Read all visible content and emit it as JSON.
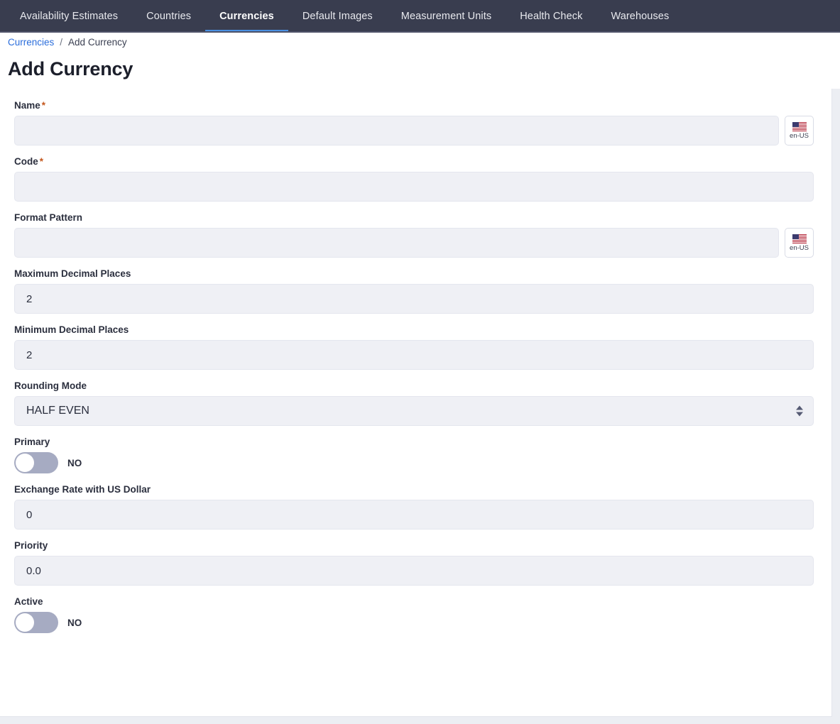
{
  "navbar": {
    "tabs": [
      {
        "label": "Availability Estimates",
        "active": false
      },
      {
        "label": "Countries",
        "active": false
      },
      {
        "label": "Currencies",
        "active": true
      },
      {
        "label": "Default Images",
        "active": false
      },
      {
        "label": "Measurement Units",
        "active": false
      },
      {
        "label": "Health Check",
        "active": false
      },
      {
        "label": "Warehouses",
        "active": false
      }
    ],
    "active_color": "#4a90e2",
    "background": "#393d4f"
  },
  "breadcrumb": {
    "parent": "Currencies",
    "separator": "/",
    "current": "Add Currency"
  },
  "page": {
    "title": "Add Currency"
  },
  "form": {
    "name": {
      "label": "Name",
      "required_marker": "*",
      "value": "",
      "placeholder": "",
      "locale": "en-US",
      "locale_icon": "us-flag-icon"
    },
    "code": {
      "label": "Code",
      "required_marker": "*",
      "value": "",
      "placeholder": ""
    },
    "format_pattern": {
      "label": "Format Pattern",
      "value": "",
      "placeholder": "",
      "locale": "en-US",
      "locale_icon": "us-flag-icon"
    },
    "maximum_decimal_places": {
      "label": "Maximum Decimal Places",
      "value": "2"
    },
    "minimum_decimal_places": {
      "label": "Minimum Decimal Places",
      "value": "2"
    },
    "rounding_mode": {
      "label": "Rounding Mode",
      "value": "HALF EVEN",
      "options": [
        "HALF EVEN"
      ]
    },
    "primary": {
      "label": "Primary",
      "state_text": "NO",
      "checked": false
    },
    "exchange_rate": {
      "label": "Exchange Rate with US Dollar",
      "value": "0"
    },
    "priority": {
      "label": "Priority",
      "value": "0.0"
    },
    "active": {
      "label": "Active",
      "state_text": "NO",
      "checked": false
    }
  },
  "colors": {
    "required_asterisk": "#c4571d",
    "link": "#2a6ddb",
    "input_background": "#eff0f5",
    "toggle_off": "#a6abc2"
  }
}
